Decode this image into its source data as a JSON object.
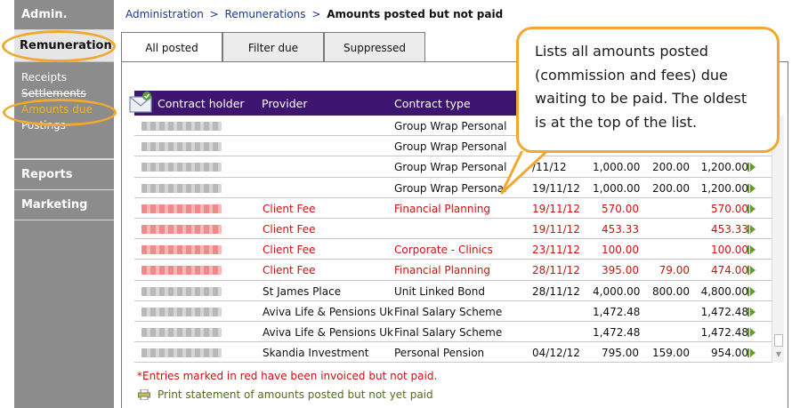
{
  "sidebar": {
    "admin": "Admin.",
    "remuneration": "Remuneration",
    "items": [
      "Receipts",
      "Settlements",
      "Amounts due",
      "Postings"
    ],
    "reports": "Reports",
    "marketing": "Marketing"
  },
  "breadcrumb": {
    "crumb1": "Administration",
    "crumb2": "Remunerations",
    "current": "Amounts posted but not paid",
    "separator": ">"
  },
  "tabs": [
    "All posted",
    "Filter due",
    "Suppressed"
  ],
  "table": {
    "headers": {
      "holder": "Contract holder",
      "provider": "Provider",
      "type": "Contract type"
    },
    "rows": [
      {
        "provider": "",
        "type": "Group Wrap Personal",
        "date": "",
        "amount": "",
        "vat": "",
        "total": "",
        "red": false
      },
      {
        "provider": "",
        "type": "Group Wrap Personal",
        "date": "",
        "amount": "",
        "vat": "",
        "total": "",
        "red": false
      },
      {
        "provider": "",
        "type": "Group Wrap Personal",
        "date": "/11/12",
        "amount": "1,000.00",
        "vat": "200.00",
        "total": "1,200.00",
        "red": false
      },
      {
        "provider": "",
        "type": "Group Wrap Personal",
        "date": "19/11/12",
        "amount": "1,000.00",
        "vat": "200.00",
        "total": "1,200.00",
        "red": false
      },
      {
        "provider": "Client Fee",
        "type": "Financial Planning",
        "date": "19/11/12",
        "amount": "570.00",
        "vat": "",
        "total": "570.00",
        "red": true
      },
      {
        "provider": "Client Fee",
        "type": "",
        "date": "19/11/12",
        "amount": "453.33",
        "vat": "",
        "total": "453.33",
        "red": true
      },
      {
        "provider": "Client Fee",
        "type": "Corporate - Clinics",
        "date": "23/11/12",
        "amount": "100.00",
        "vat": "",
        "total": "100.00",
        "red": true
      },
      {
        "provider": "Client Fee",
        "type": "Financial Planning",
        "date": "28/11/12",
        "amount": "395.00",
        "vat": "79.00",
        "total": "474.00",
        "red": true
      },
      {
        "provider": "St James Place",
        "type": "Unit Linked Bond",
        "date": "28/11/12",
        "amount": "4,000.00",
        "vat": "800.00",
        "total": "4,800.00",
        "red": false
      },
      {
        "provider": "Aviva Life & Pensions Uk",
        "type": "Final Salary Scheme",
        "date": "",
        "amount": "1,472.48",
        "vat": "",
        "total": "1,472.48",
        "red": false
      },
      {
        "provider": "Aviva Life & Pensions Uk",
        "type": "Final Salary Scheme",
        "date": "",
        "amount": "1,472.48",
        "vat": "",
        "total": "1,472.48",
        "red": false
      },
      {
        "provider": "Skandia Investment",
        "type": "Personal Pension",
        "date": "04/12/12",
        "amount": "795.00",
        "vat": "159.00",
        "total": "954.00",
        "red": false
      }
    ]
  },
  "footnote": "*Entries marked in red have been invoiced but not paid.",
  "print_link": "Print statement of amounts posted but not yet paid",
  "callout": "Lists all amounts posted (commission and fees) due waiting to be paid. The oldest is at the top of the list.",
  "colors": {
    "header_bg": "#3d1470",
    "highlight": "#f0a830",
    "red_text": "#d01010",
    "link": "#1a3a8a"
  },
  "icons": [
    "mail-icon",
    "arrow-right-icon",
    "printer-icon"
  ]
}
